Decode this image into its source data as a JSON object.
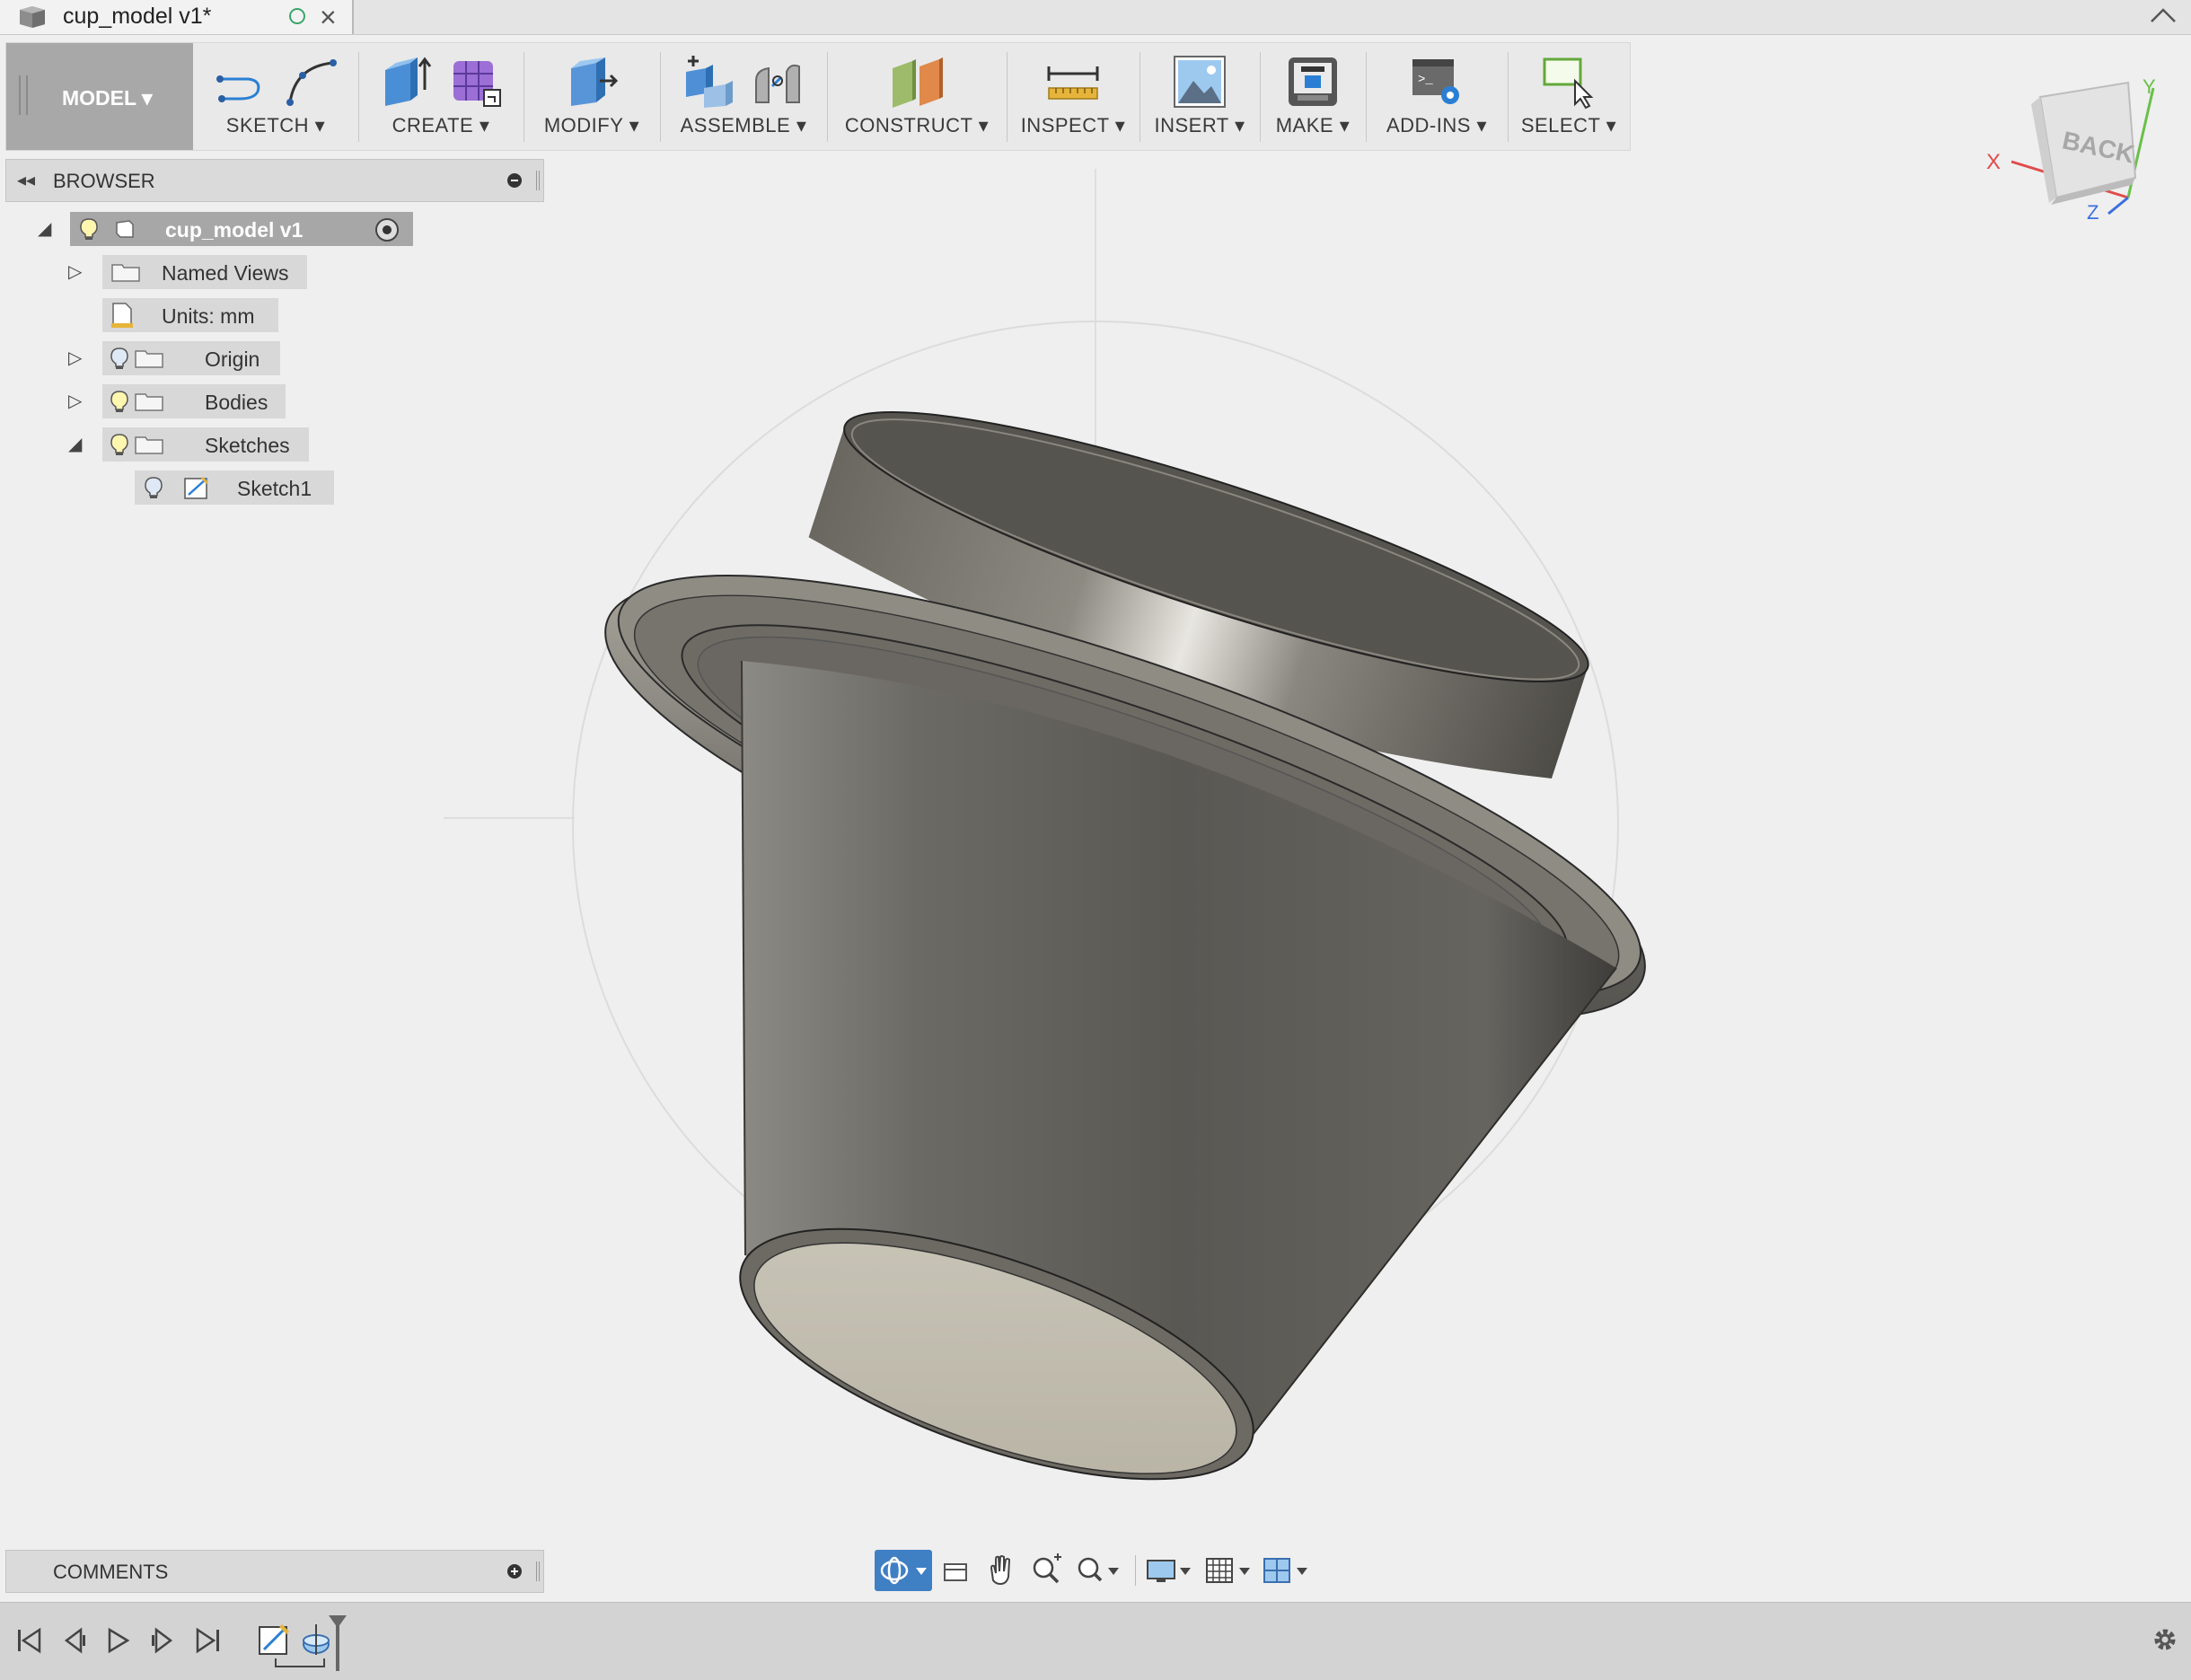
{
  "document": {
    "tab_title": "cup_model v1*",
    "close_glyph": "×"
  },
  "toolbar": {
    "mode_label": "MODEL ▾",
    "groups": [
      {
        "label": "SKETCH ▾",
        "icons": [
          "sketch-line-icon",
          "sketch-arc-icon"
        ]
      },
      {
        "label": "CREATE ▾",
        "icons": [
          "extrude-icon",
          "form-icon"
        ]
      },
      {
        "label": "MODIFY ▾",
        "icons": [
          "press-pull-icon"
        ]
      },
      {
        "label": "ASSEMBLE ▾",
        "icons": [
          "new-component-icon",
          "joint-icon"
        ]
      },
      {
        "label": "CONSTRUCT ▾",
        "icons": [
          "offset-plane-icon"
        ]
      },
      {
        "label": "INSPECT ▾",
        "icons": [
          "measure-icon"
        ]
      },
      {
        "label": "INSERT ▾",
        "icons": [
          "insert-image-icon"
        ]
      },
      {
        "label": "MAKE ▾",
        "icons": [
          "3d-print-icon"
        ]
      },
      {
        "label": "ADD-INS ▾",
        "icons": [
          "scripts-icon"
        ]
      },
      {
        "label": "SELECT ▾",
        "icons": [
          "select-window-icon"
        ]
      }
    ],
    "accent_color": "#2a7fd4"
  },
  "browser": {
    "title": "BROWSER",
    "root": "cup_model v1",
    "items": [
      {
        "label": "Named Views"
      },
      {
        "label": "Units: mm"
      },
      {
        "label": "Origin"
      },
      {
        "label": "Bodies"
      },
      {
        "label": "Sketches"
      },
      {
        "label": "Sketch1"
      }
    ]
  },
  "viewcube": {
    "face_label": "BACK",
    "axis_x": "X",
    "axis_y": "Y",
    "axis_z": "Z"
  },
  "comments": {
    "title": "COMMENTS"
  },
  "navbar": {
    "tools": [
      "orbit-icon",
      "look-at-icon",
      "pan-icon",
      "zoom-icon",
      "zoom-window-icon",
      "display-settings-icon",
      "grid-icon",
      "viewports-icon"
    ]
  },
  "timeline": {
    "controls": [
      "skip-start-icon",
      "step-back-icon",
      "play-icon",
      "step-forward-icon",
      "skip-end-icon"
    ],
    "features": [
      "sketch-feature-icon",
      "revolve-feature-icon"
    ]
  }
}
